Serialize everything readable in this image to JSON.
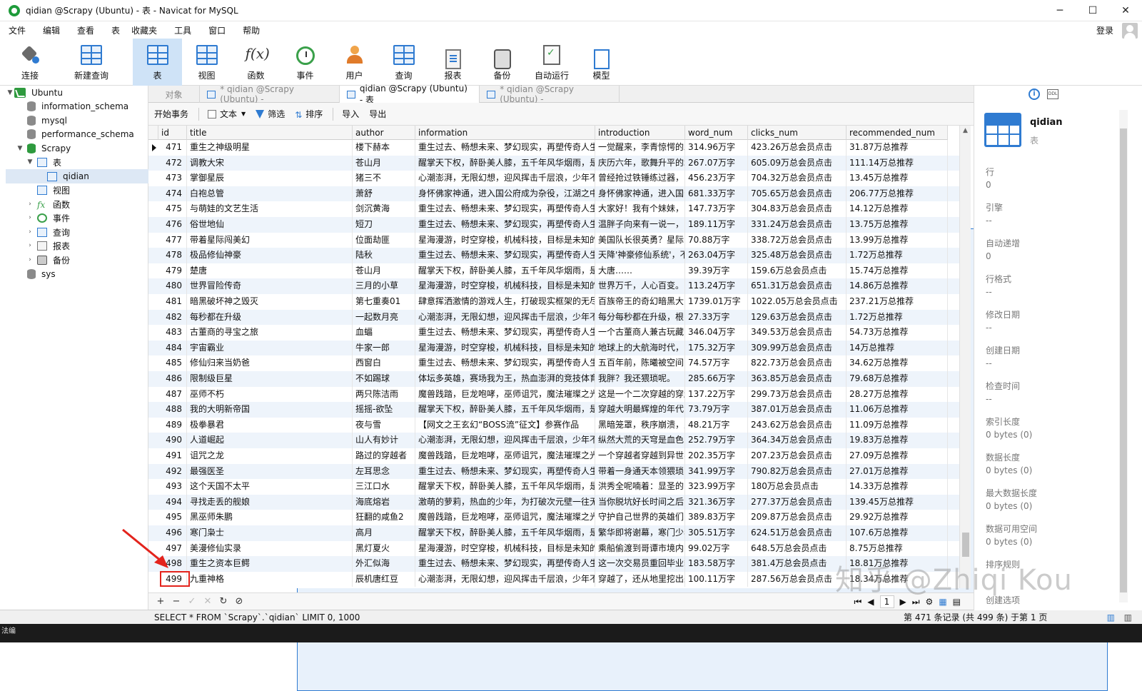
{
  "window": {
    "title": "qidian @Scrapy (Ubuntu) - 表 - Navicat for MySQL",
    "controls": [
      "─",
      "☐",
      "✕"
    ]
  },
  "menu": [
    "文件",
    "编辑",
    "查看",
    "表",
    "收藏夹",
    "工具",
    "窗口",
    "帮助"
  ],
  "login_label": "登录",
  "toolbar": {
    "items": [
      {
        "label": "连接",
        "icon": "connection-icon"
      },
      {
        "label": "新建查询",
        "icon": "new-query-icon"
      },
      {
        "label": "表",
        "icon": "table-icon",
        "active": true
      },
      {
        "label": "视图",
        "icon": "view-icon"
      },
      {
        "label": "函数",
        "icon": "function-icon"
      },
      {
        "label": "事件",
        "icon": "event-icon"
      },
      {
        "label": "用户",
        "icon": "user-icon"
      },
      {
        "label": "查询",
        "icon": "query-icon"
      },
      {
        "label": "报表",
        "icon": "report-icon"
      },
      {
        "label": "备份",
        "icon": "backup-icon"
      },
      {
        "label": "自动运行",
        "icon": "automation-icon"
      },
      {
        "label": "模型",
        "icon": "model-icon"
      }
    ]
  },
  "nav": {
    "connection": "Ubuntu",
    "databases": [
      "information_schema",
      "mysql",
      "performance_schema",
      "Scrapy"
    ],
    "scrapy_children": [
      "表",
      "qidian",
      "视图",
      "函数",
      "事件",
      "查询",
      "报表",
      "备份"
    ],
    "sys": "sys"
  },
  "tabs": [
    {
      "label": "对象"
    },
    {
      "label": "* qidian @Scrapy (Ubuntu) -"
    },
    {
      "label": "qidian @Scrapy (Ubuntu) - 表",
      "active": true
    },
    {
      "label": "* qidian @Scrapy (Ubuntu) -"
    }
  ],
  "subtoolbar": [
    "开始事务",
    "文本",
    "筛选",
    "排序",
    "导入",
    "导出"
  ],
  "columns": [
    "id",
    "title",
    "author",
    "information",
    "introduction",
    "word_num",
    "clicks_num",
    "recommended_num"
  ],
  "rows": [
    [
      "471",
      "重生之神级明星",
      "楼下赫本",
      "重生过去、畅想未来、梦幻现实，再塑传奇人生",
      "一觉醒来，李青惊愕的发",
      "314.96万字",
      "423.26万总会员点击",
      "31.87万总推荐"
    ],
    [
      "472",
      "调教大宋",
      "苍山月",
      "醒掌天下权，醉卧美人膝，五千年风华烟雨，是",
      "庆历六年，歌舞升平的北",
      "267.07万字",
      "605.09万总会员点击",
      "111.14万总推荐"
    ],
    [
      "473",
      "掌御星辰",
      "猪三不",
      "心潮澎湃，无限幻想，迎风挥击千层浪，少年不",
      "曾经抢过铁锤练过器，",
      "456.23万字",
      "704.32万总会员点击",
      "13.45万总推荐"
    ],
    [
      "474",
      "白袍总管",
      "萧舒",
      "身怀佛家神通，进入国公府成为杂役，江湖之中",
      "身怀佛家神通，进入国公",
      "681.33万字",
      "705.65万总会员点击",
      "206.77万总推荐"
    ],
    [
      "475",
      "与萌娃的文艺生活",
      "剑沉黄海",
      "重生过去、畅想未来、梦幻现实，再塑传奇人生",
      "大家好！我有个妹妹，",
      "147.73万字",
      "304.83万总会员点击",
      "14.12万总推荐"
    ],
    [
      "476",
      "俗世地仙",
      "短刀",
      "重生过去、畅想未来、梦幻现实，再塑传奇人生",
      "温胖子向来有一说一，",
      "189.11万字",
      "331.24万总会员点击",
      "13.75万总推荐"
    ],
    [
      "477",
      "带着星际闯美幻",
      "位面劫匪",
      "星海漫游，时空穿梭，机械科技，目标是未知的",
      "美国队长很英勇？星际",
      "70.88万字",
      "338.72万总会员点击",
      "13.99万总推荐"
    ],
    [
      "478",
      "极品修仙神豪",
      "陆秋",
      "重生过去、畅想未来、梦幻现实，再塑传奇人生",
      "天降'神豪修仙系统'，不",
      "263.04万字",
      "325.48万总会员点击",
      "1.72万总推荐"
    ],
    [
      "479",
      "楚唐",
      "苍山月",
      "醒掌天下权，醉卧美人膝，五千年风华烟雨，是",
      "大唐……",
      "39.39万字",
      "159.6万总会员点击",
      "15.74万总推荐"
    ],
    [
      "480",
      "世界冒险传奇",
      "三月的小草",
      "星海漫游，时空穿梭，机械科技，目标是未知的",
      "世界万千，人心百变。",
      "113.24万字",
      "651.31万总会员点击",
      "14.86万总推荐"
    ],
    [
      "481",
      "暗黑破坏神之毁灭",
      "第七重奏01",
      "肆意挥洒激情的游戏人生，打破现实框架的无尽",
      "百族帝王的奇幻暗黑大",
      "1739.01万字",
      "1022.05万总会员点击",
      "237.21万总推荐"
    ],
    [
      "482",
      "每秒都在升级",
      "一起数月亮",
      "心潮澎湃，无限幻想，迎风挥击千层浪，少年不",
      "每分每秒都在升级，根",
      "27.33万字",
      "129.63万总会员点击",
      "1.72万总推荐"
    ],
    [
      "483",
      "古董商的寻宝之旅",
      "血蝠",
      "重生过去、畅想未来、梦幻现实，再塑传奇人生",
      "一个古董商人兼古玩藏",
      "346.04万字",
      "349.53万总会员点击",
      "54.73万总推荐"
    ],
    [
      "484",
      "宇宙霸业",
      "牛家一郎",
      "星海漫游，时空穿梭，机械科技，目标是未知的",
      "地球上的大航海时代，",
      "175.32万字",
      "309.99万总会员点击",
      "14万总推荐"
    ],
    [
      "485",
      "修仙归来当奶爸",
      "西窗白",
      "重生过去、畅想未来、梦幻现实，再塑传奇人生",
      "五百年前，陈曦被空间",
      "74.57万字",
      "822.73万总会员点击",
      "34.62万总推荐"
    ],
    [
      "486",
      "限制级巨星",
      "不如踢球",
      "体坛多英雄，赛场我为王，热血澎湃的竞技体育",
      "我胖？我还猥琐呢。",
      "285.66万字",
      "363.85万总会员点击",
      "79.68万总推荐"
    ],
    [
      "487",
      "巫师不朽",
      "两只陈洁雨",
      "魔兽践踏，巨龙咆哮，巫师诅咒，魔法璀璨之光",
      "这是一个二次穿越的穿越",
      "137.22万字",
      "299.73万总会员点击",
      "28.27万总推荐"
    ],
    [
      "488",
      "我的大明新帝国",
      "摇摇-欲坠",
      "醒掌天下权，醉卧美人膝，五千年风华烟雨，是",
      "穿越大明最辉煌的年代，",
      "73.79万字",
      "387.01万总会员点击",
      "11.06万总推荐"
    ],
    [
      "489",
      "极拳暴君",
      "夜与雪",
      "【网文之王玄幻“BOSS流”征文】参赛作品",
      "黑暗笼罩，秩序崩溃，人",
      "48.21万字",
      "243.62万总会员点击",
      "11.09万总推荐"
    ],
    [
      "490",
      "人道崛起",
      "山人有妙计",
      "心潮澎湃，无限幻想，迎风挥击千层浪，少年不",
      "纵然大荒的天穹是血色的",
      "252.79万字",
      "364.34万总会员点击",
      "19.83万总推荐"
    ],
    [
      "491",
      "诅咒之龙",
      "路过的穿越者",
      "魔兽践踏，巨龙咆哮，巫师诅咒，魔法璀璨之光",
      "一个穿越者穿越到异世界",
      "202.35万字",
      "207.23万总会员点击",
      "27.09万总推荐"
    ],
    [
      "492",
      "最强医圣",
      "左耳思念",
      "重生过去、畅想未来、梦幻现实，再塑传奇人生",
      "带着一身通天本领猥琐的",
      "341.99万字",
      "790.82万总会员点击",
      "27.01万总推荐"
    ],
    [
      "493",
      "这个天国不太平",
      "三江口水",
      "醒掌天下权，醉卧美人膝，五千年风华烟雨，是",
      "洪秀全呢喃着：显圣的",
      "323.99万字",
      "180万总会员点击",
      "14.33万总推荐"
    ],
    [
      "494",
      "寻找走丢的舰娘",
      "海底熔岩",
      "激萌的萝莉，热血的少年，为打破次元壁一往无",
      "当你脱坑好长时间之后，",
      "321.36万字",
      "277.37万总会员点击",
      "139.45万总推荐"
    ],
    [
      "495",
      "黑巫师朱鹏",
      "狂翻的咸鱼2",
      "魔兽践踏，巨龙咆哮，巫师诅咒，魔法璀璨之光",
      "守护自己世界的英雄们，",
      "389.83万字",
      "209.87万总会员点击",
      "29.92万总推荐"
    ],
    [
      "496",
      "寒门枭士",
      "高月",
      "醒掌天下权，醉卧美人膝，五千年风华烟雨，是",
      "繁华即将谢幕，寒门少年",
      "305.51万字",
      "624.51万总会员点击",
      "107.6万总推荐"
    ],
    [
      "497",
      "美漫修仙实录",
      "黑灯夏火",
      "星海漫游，时空穿梭，机械科技，目标是未知的",
      "乘船偷渡到哥谭市境内的",
      "99.02万字",
      "648.5万总会员点击",
      "8.75万总推荐"
    ],
    [
      "498",
      "重生之资本巨鳄",
      "外汇似海",
      "重生过去、畅想未来、梦幻现实，再塑传奇人生",
      "这一次交易员重回毕业季，",
      "183.58万字",
      "381.4万总会员点击",
      "18.81万总推荐"
    ],
    [
      "499",
      "九重神格",
      "辰机唐红豆",
      "心潮澎湃，无限幻想，迎风挥击千层浪，少年不",
      "穿越了，还从地里挖出来",
      "100.11万字",
      "287.56万总会员点击",
      "18.34万总推荐"
    ]
  ],
  "footer": {
    "buttons": [
      "+",
      "−",
      "✓",
      "✕",
      "↻",
      "⊘"
    ],
    "page": "1",
    "record_info": "第 471 条记录 (共 499 条) 于第 1 页"
  },
  "status_sql": "SELECT * FROM `Scrapy`.`qidian` LIMIT 0, 1000",
  "bottom_text": "法编",
  "info": {
    "name": "qidian",
    "type": "表",
    "props": [
      {
        "label": "行",
        "value": "0"
      },
      {
        "label": "引擎",
        "value": "--"
      },
      {
        "label": "自动递增",
        "value": "0"
      },
      {
        "label": "行格式",
        "value": "--"
      },
      {
        "label": "修改日期",
        "value": "--"
      },
      {
        "label": "创建日期",
        "value": "--"
      },
      {
        "label": "检查时间",
        "value": "--"
      },
      {
        "label": "索引长度",
        "value": "0 bytes (0)"
      },
      {
        "label": "数据长度",
        "value": "0 bytes (0)"
      },
      {
        "label": "最大数据长度",
        "value": "0 bytes (0)"
      },
      {
        "label": "数据可用空间",
        "value": "0 bytes (0)"
      },
      {
        "label": "排序规则",
        "value": ""
      },
      {
        "label": "创建选项",
        "value": ""
      }
    ]
  },
  "watermark": "知乎 @Zhiqi Kou",
  "colors": {
    "accent": "#2f7bd1",
    "active_tool": "#cfe3f7",
    "highlight": "#e3231c",
    "alt_row": "#eef4fb"
  }
}
